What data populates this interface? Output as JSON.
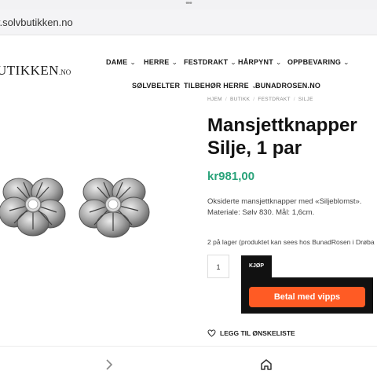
{
  "browser": {
    "url": "v.solvbutikken.no"
  },
  "header": {
    "logo_text": "UTIKKEN",
    "logo_suffix": ".NO",
    "nav": [
      {
        "label": "DAME"
      },
      {
        "label": "HERRE"
      },
      {
        "label": "FESTDRAKT"
      },
      {
        "label": "HÅRPYNT"
      },
      {
        "label": "OPPBEVARING"
      },
      {
        "label": "SØLVBELTER"
      },
      {
        "label": "TILBEHØR HERRE"
      },
      {
        "label": "BUNADROSEN.NO"
      }
    ]
  },
  "breadcrumb": [
    "HJEM",
    "BUTIKK",
    "FESTDRAKT",
    "SILJE"
  ],
  "product": {
    "title": "Mansjettknapper Silje, 1 par",
    "price": "kr981,00",
    "description": "Oksiderte mansjettknapper med «Siljeblomst». Materiale: Sølv 830. Mål: 1,6cm.",
    "stock": "2 på lager (produktet kan sees hos BunadRosen i Drøba",
    "quantity": "1",
    "buy_label": "KJØP",
    "vipps_label": "Betal med vipps",
    "wishlist_label": "LEGG TIL ØNSKELISTE",
    "image_alt": "product-photo-earrings"
  },
  "colors": {
    "price": "#2aa37a",
    "vipps": "#ff5b24",
    "buy_bg": "#111111"
  }
}
